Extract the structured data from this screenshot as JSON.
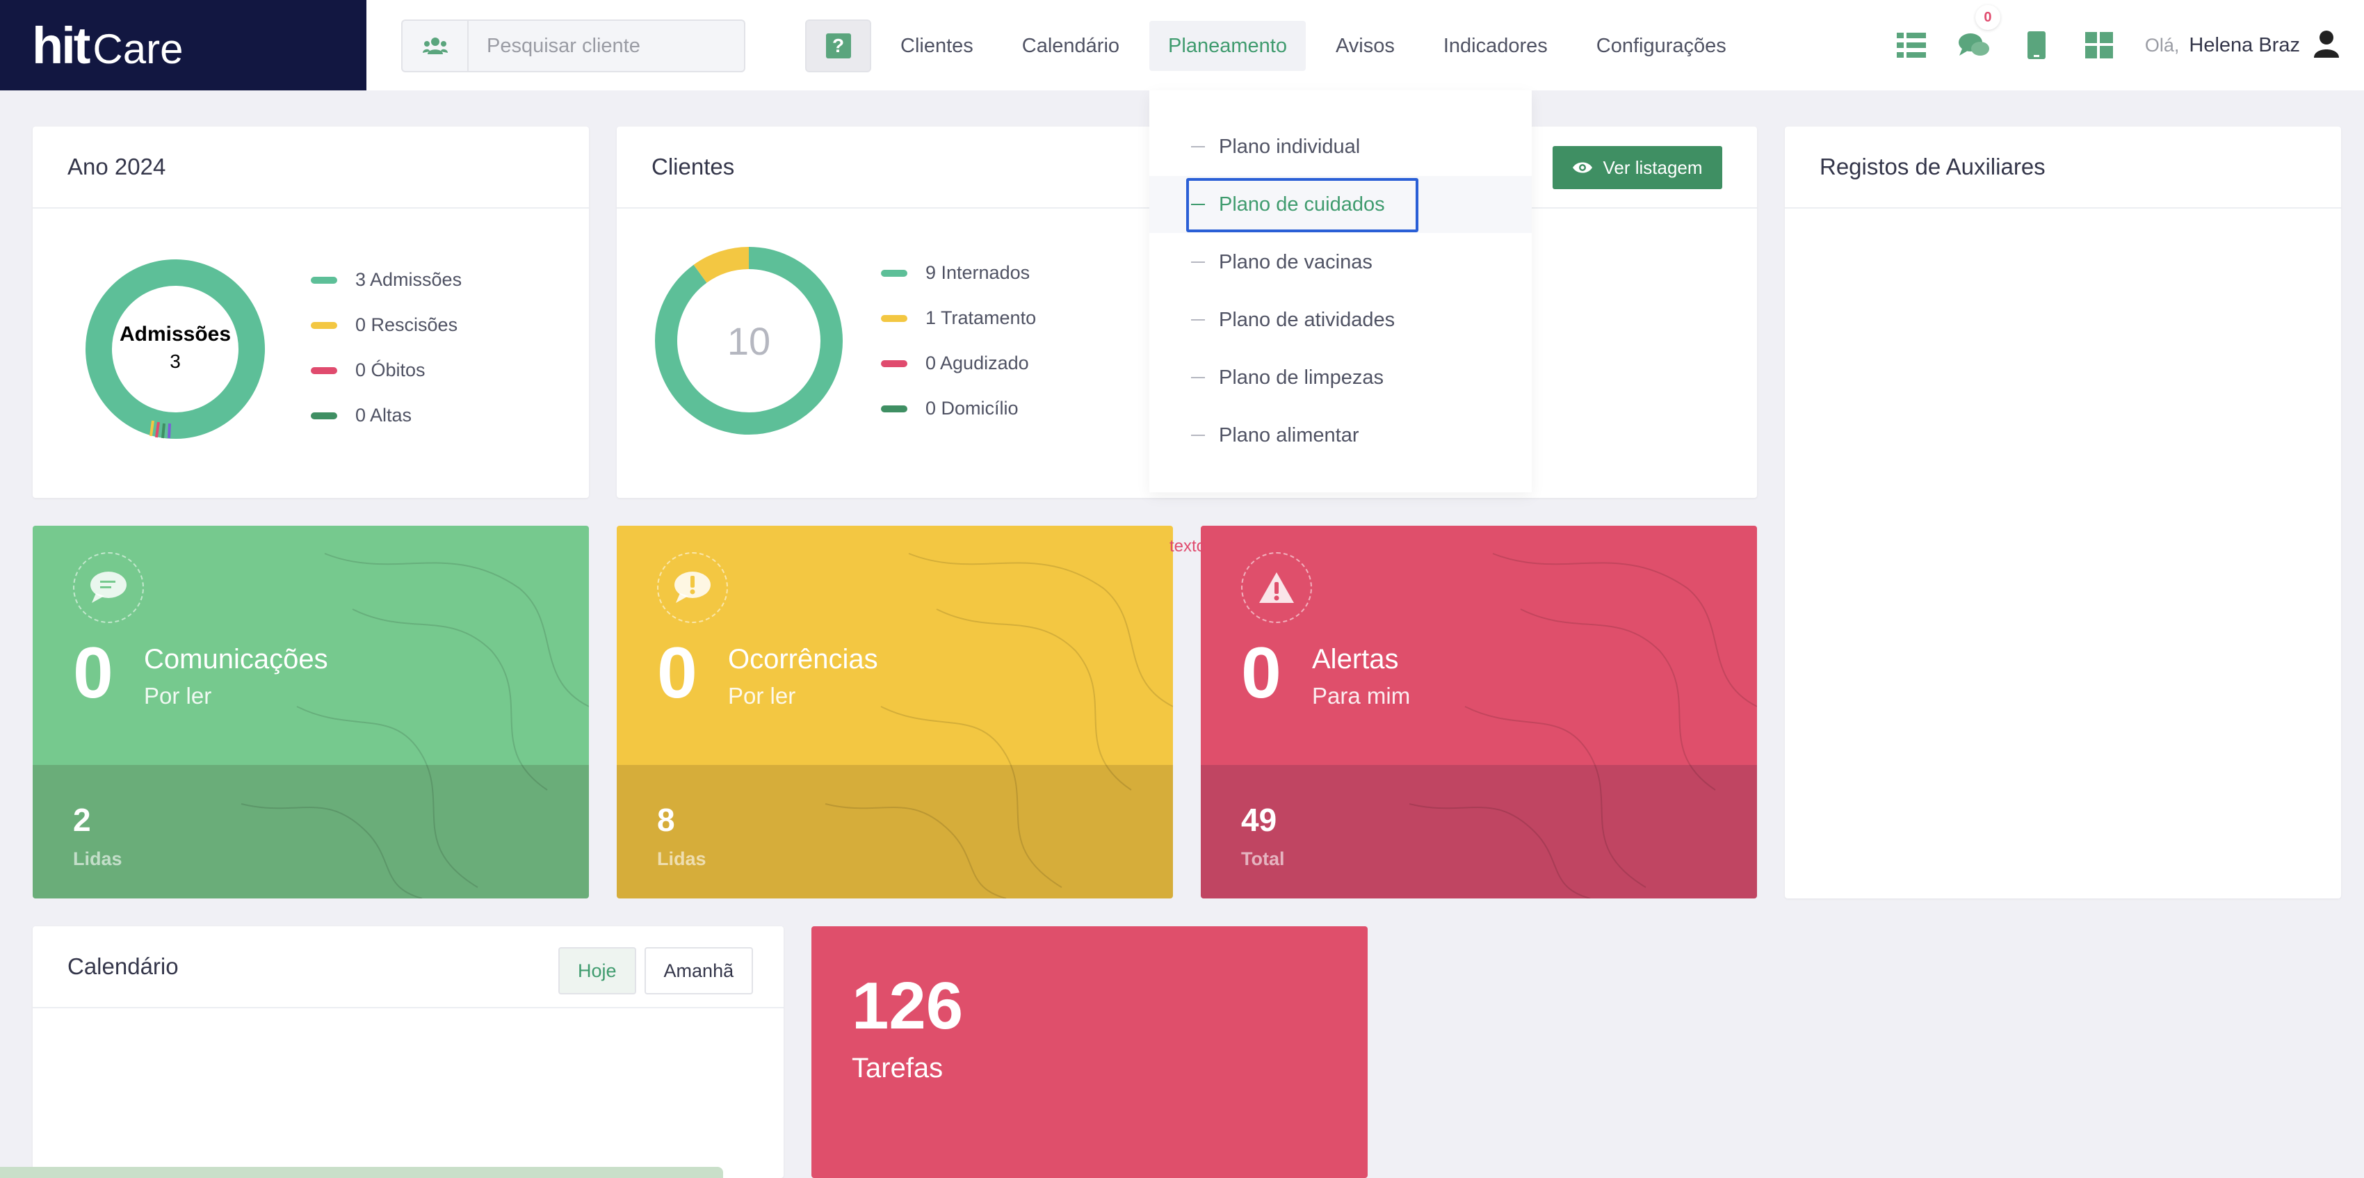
{
  "app": {
    "logo_hit": "hit",
    "logo_care": "Care"
  },
  "search": {
    "placeholder": "Pesquisar cliente",
    "help_label": "?"
  },
  "nav": {
    "items": [
      {
        "label": "Clientes"
      },
      {
        "label": "Calendário"
      },
      {
        "label": "Planeamento"
      },
      {
        "label": "Avisos"
      },
      {
        "label": "Indicadores"
      },
      {
        "label": "Configurações"
      }
    ],
    "active": "Planeamento"
  },
  "header": {
    "messages_count": "0",
    "greeting": "Olá,",
    "user_name": "Helena Braz",
    "icons": [
      "list-view-icon",
      "chat-icon",
      "tablet-icon",
      "dashboard-icon",
      "user-icon"
    ]
  },
  "year_card": {
    "title": "Ano 2024",
    "donut_label": "Admissões",
    "donut_value": "3",
    "legend": [
      {
        "label": "3 Admissões",
        "color": "#5dbf98"
      },
      {
        "label": "0 Rescisões",
        "color": "#f3c742"
      },
      {
        "label": "0 Óbitos",
        "color": "#e04b6e"
      },
      {
        "label": "0 Altas",
        "color": "#3f8f63"
      }
    ]
  },
  "clients_card": {
    "title": "Clientes",
    "center_value": "10",
    "button_label": "Ver listagem",
    "legend": [
      {
        "label": "9 Internados",
        "color": "#5dbf98"
      },
      {
        "label": "1 Tratamento",
        "color": "#f3c742"
      },
      {
        "label": "0 Agudizado",
        "color": "#e04b6e"
      },
      {
        "label": "0 Domicílio",
        "color": "#3f8f63"
      }
    ]
  },
  "chart_data": {
    "type": "pie",
    "categories": [
      "Internados",
      "Tratamento",
      "Agudizado",
      "Domicílio"
    ],
    "values": [
      9,
      1,
      0,
      0
    ],
    "title": "Clientes"
  },
  "aux_card": {
    "title": "Registos de Auxiliares"
  },
  "planeamento_menu": {
    "items": [
      {
        "label": "Plano individual"
      },
      {
        "label": "Plano de cuidados"
      },
      {
        "label": "Plano de vacinas"
      },
      {
        "label": "Plano de atividades"
      },
      {
        "label": "Plano de limpezas"
      },
      {
        "label": "Plano alimentar"
      }
    ],
    "selected": "Plano de cuidados"
  },
  "stray_text": "texto",
  "tiles": {
    "comunicacoes": {
      "count": "0",
      "title": "Comunicações",
      "subtitle": "Por ler",
      "secondary_count": "2",
      "secondary_label": "Lidas"
    },
    "ocorrencias": {
      "count": "0",
      "title": "Ocorrências",
      "subtitle": "Por ler",
      "secondary_count": "8",
      "secondary_label": "Lidas"
    },
    "alertas": {
      "count": "0",
      "title": "Alertas",
      "subtitle": "Para mim",
      "secondary_count": "49",
      "secondary_label": "Total"
    }
  },
  "calendar_card": {
    "title": "Calendário",
    "today_label": "Hoje",
    "tomorrow_label": "Amanhã"
  },
  "tasks_tile": {
    "count": "126",
    "label": "Tarefas"
  }
}
